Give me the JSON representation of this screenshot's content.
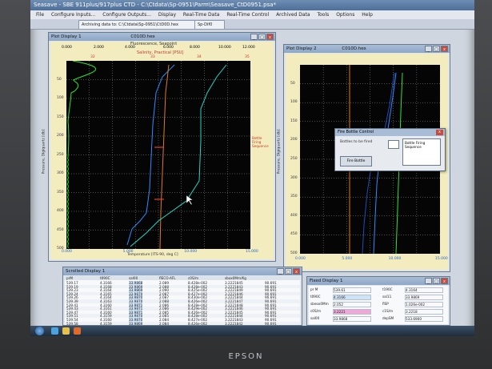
{
  "app": {
    "title": "Seasave - SBE 911plus/917plus CTD - C:\\Ctdata\\Sp-0951\\Parm\\Seasave_CtD0951.psa*",
    "menu": [
      "File",
      "Configure Inputs...",
      "Configure Outputs...",
      "Display",
      "Real-Time Data",
      "Real-Time Control",
      "Archived Data",
      "Tools",
      "Options",
      "Help"
    ],
    "tabs": [
      "Archiving data to: C:\\Ctdata\\Sp-0951\\CtD0D.hex",
      "Sp-Dif0"
    ]
  },
  "plot1": {
    "window_title": "Plot Display 1",
    "file": "C010D.hex",
    "top_label_1": "Fluorescence, Seapoint",
    "top_label_2": "Salinity, Practical [PSU]",
    "top_ticks": [
      "0.000",
      "2.000",
      "4.000",
      "6.000",
      "8.000",
      "10.000",
      "12.000"
    ],
    "sal_ticks": [
      "32",
      "33",
      "34",
      "35"
    ],
    "ylabel": "Pressure, Digiquartz [db]",
    "y_ticks": [
      "50",
      "100",
      "150",
      "200",
      "250",
      "300",
      "350",
      "400",
      "450",
      "500"
    ],
    "xlabel": "Temperature [ITS-90, deg C]",
    "x_ticks": [
      "0.000",
      "5.000",
      "10.000",
      "15.000"
    ],
    "side_text": "Bottle Firing Sequence"
  },
  "plot2": {
    "window_title": "Plot Display 2",
    "file": "C010D.hex",
    "ylabel": "Pressure, Digiquartz [db]",
    "y_ticks": [
      "50",
      "100",
      "150",
      "200",
      "250",
      "300",
      "350",
      "400",
      "450",
      "500"
    ],
    "x_ticks": [
      "0.000",
      "5.000",
      "10.000",
      "15.000"
    ]
  },
  "dialog": {
    "title": "Fire Bottle Control",
    "row_label": "Bottles to be fired",
    "fire_label": "Fire Bottle",
    "status": "Bottle Firing Sequence"
  },
  "scrolled": {
    "window_title": "Scrolled Display 1",
    "headers": [
      "prM",
      "t090C",
      "sal00",
      "flECO-AFL",
      "c0S/m",
      "sbox0Mm/Kg"
    ],
    "rows": [
      [
        "539.17",
        "4.3166",
        "33.9868",
        "2.089",
        "8.428e-002",
        "3.2221845"
      ],
      [
        "539.19",
        "4.3168",
        "33.9869",
        "2.088",
        "8.428e-002",
        "3.2221843"
      ],
      [
        "539.23",
        "4.3164",
        "33.9869",
        "2.090",
        "8.425e-002",
        "3.2221849"
      ],
      [
        "539.24",
        "4.3165",
        "33.9870",
        "2.087",
        "8.427e-002",
        "3.2221846"
      ],
      [
        "539.26",
        "4.3164",
        "33.9870",
        "2.087",
        "8.430e-002",
        "3.2221844"
      ],
      [
        "539.39",
        "4.3163",
        "33.9870",
        "2.088",
        "8.426e-002",
        "3.2221847"
      ],
      [
        "539.41",
        "4.3160",
        "33.9871",
        "2.086",
        "8.428e-002",
        "3.2221848"
      ],
      [
        "539.43",
        "4.3161",
        "33.9871",
        "2.086",
        "8.429e-002",
        "3.2221846"
      ],
      [
        "539.47",
        "4.3160",
        "33.9871",
        "2.085",
        "8.426e-002",
        "3.2221845"
      ],
      [
        "539.51",
        "4.3159",
        "33.9870",
        "2.085",
        "8.428e-002",
        "3.2221844"
      ],
      [
        "539.54",
        "4.3160",
        "33.9870",
        "2.084",
        "8.427e-002",
        "3.2221843"
      ],
      [
        "539.58",
        "4.3159",
        "33.9869",
        "2.084",
        "8.426e-002",
        "3.2221842"
      ]
    ],
    "extra": [
      "90.691",
      "90.691",
      "90.691",
      "90.691",
      "90.691",
      "90.691",
      "90.691",
      "90.691",
      "90.691",
      "90.691",
      "90.691",
      "90.691"
    ]
  },
  "fixed": {
    "window_title": "Fixed Display 1",
    "left": [
      {
        "label": "pr M",
        "value": "539.61"
      },
      {
        "label": "t090C",
        "value": "4.3166"
      },
      {
        "label": "sbeox0Mm",
        "value": "2.052"
      },
      {
        "label": "c0S/m",
        "value": "3.2221"
      },
      {
        "label": "sal00",
        "value": "33.9868"
      }
    ],
    "right": [
      {
        "label": "t190C",
        "value": "4.3164"
      },
      {
        "label": "sal11",
        "value": "33.9869"
      },
      {
        "label": "flSP",
        "value": "1.026e-002"
      },
      {
        "label": "c1S/m",
        "value": "3.2218"
      },
      {
        "label": "depSM",
        "value": "533.6900"
      }
    ]
  },
  "taskbar": {
    "start_icon": "start-orb-icon"
  },
  "brand": "EPSON",
  "colors": {
    "plot_bg": "#f3ecbe",
    "grid": "#9a9a9a",
    "temp": "#2d8cff",
    "sal": "#e07a20",
    "fluor": "#2ee62e",
    "oxy": "#25d6c8"
  }
}
